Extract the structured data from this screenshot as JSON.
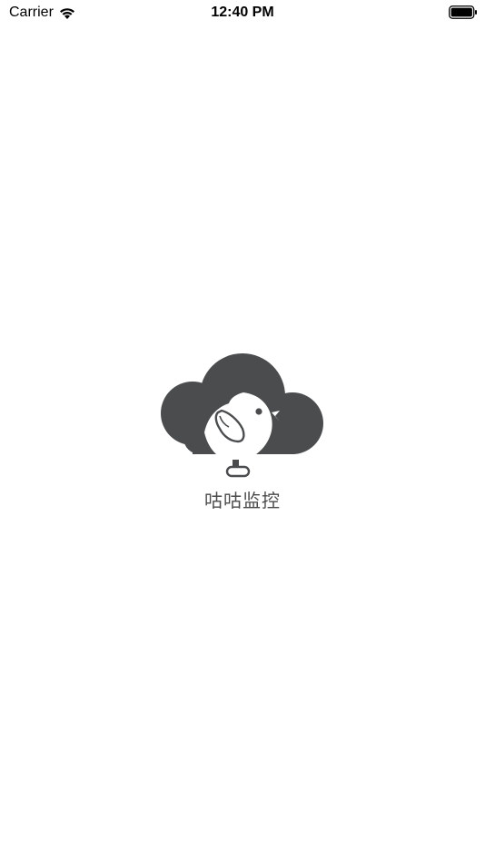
{
  "status_bar": {
    "carrier": "Carrier",
    "time": "12:40 PM",
    "wifi_icon": "wifi-icon",
    "battery_icon": "battery-icon"
  },
  "splash": {
    "logo_icon": "cloud-bird-logo-icon",
    "app_name": "咕咕监控"
  },
  "colors": {
    "logo": "#4a4c4e",
    "text": "#4a4a4a",
    "background": "#ffffff"
  }
}
